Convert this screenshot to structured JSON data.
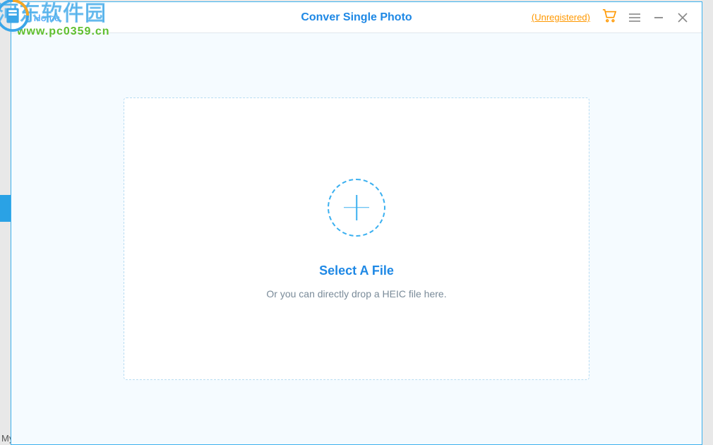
{
  "watermark": {
    "main_text": "河东软件园",
    "url_text": "www.pc0359.cn"
  },
  "header": {
    "home_label": "Home",
    "title": "Conver Single Photo",
    "unregistered_label": "(Unregistered)"
  },
  "dropzone": {
    "title": "Select A File",
    "subtitle": "Or you can directly drop a HEIC file here."
  },
  "background": {
    "bottom_fragment": "MyFone D-Port Pro"
  }
}
